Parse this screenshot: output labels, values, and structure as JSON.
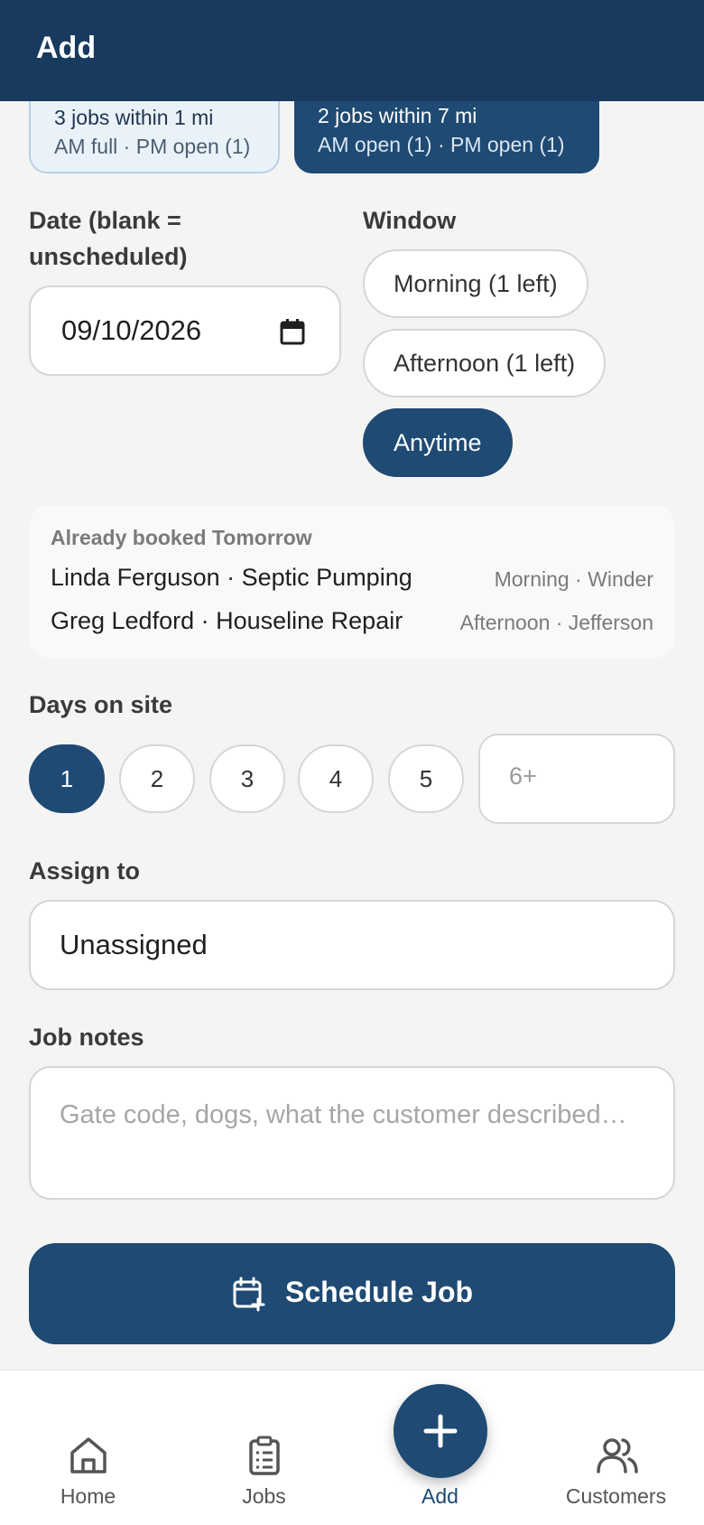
{
  "header": {
    "title": "Add"
  },
  "zones": [
    {
      "line1": "3 jobs within 1 mi",
      "line2": "AM full · PM open (1)"
    },
    {
      "line1": "2 jobs within 7 mi",
      "line2": "AM open (1) · PM open (1)"
    }
  ],
  "date": {
    "label_line1": "Date (blank =",
    "label_line2": "unscheduled)",
    "value": "09/10/2026",
    "icon": "calendar-icon"
  },
  "window": {
    "label": "Window",
    "options": [
      "Morning (1 left)",
      "Afternoon (1 left)",
      "Anytime"
    ],
    "selected": "Anytime"
  },
  "booked": {
    "heading": "Already booked Tomorrow",
    "items": [
      {
        "who": "Linda Ferguson · Septic Pumping",
        "where": "Morning · Winder"
      },
      {
        "who": "Greg Ledford · Houseline Repair",
        "where": "Afternoon · Jefferson"
      }
    ]
  },
  "days": {
    "label": "Days on site",
    "options": [
      "1",
      "2",
      "3",
      "4",
      "5"
    ],
    "selected": "1",
    "other_placeholder": "6+"
  },
  "assign": {
    "label": "Assign to",
    "value": "Unassigned"
  },
  "notes": {
    "label": "Job notes",
    "placeholder": "Gate code, dogs, what the customer described…"
  },
  "submit": {
    "label": "Schedule Job",
    "icon": "calendar-plus-icon"
  },
  "nav": {
    "items": [
      {
        "label": "Home",
        "icon": "home-icon"
      },
      {
        "label": "Jobs",
        "icon": "clipboard-list-icon"
      },
      {
        "label": "Add",
        "icon": "plus-icon"
      },
      {
        "label": "Customers",
        "icon": "users-icon"
      }
    ],
    "active": "Add"
  },
  "colors": {
    "primary": "#1e4a73",
    "header": "#173a5e",
    "background": "#f4f4f3"
  }
}
